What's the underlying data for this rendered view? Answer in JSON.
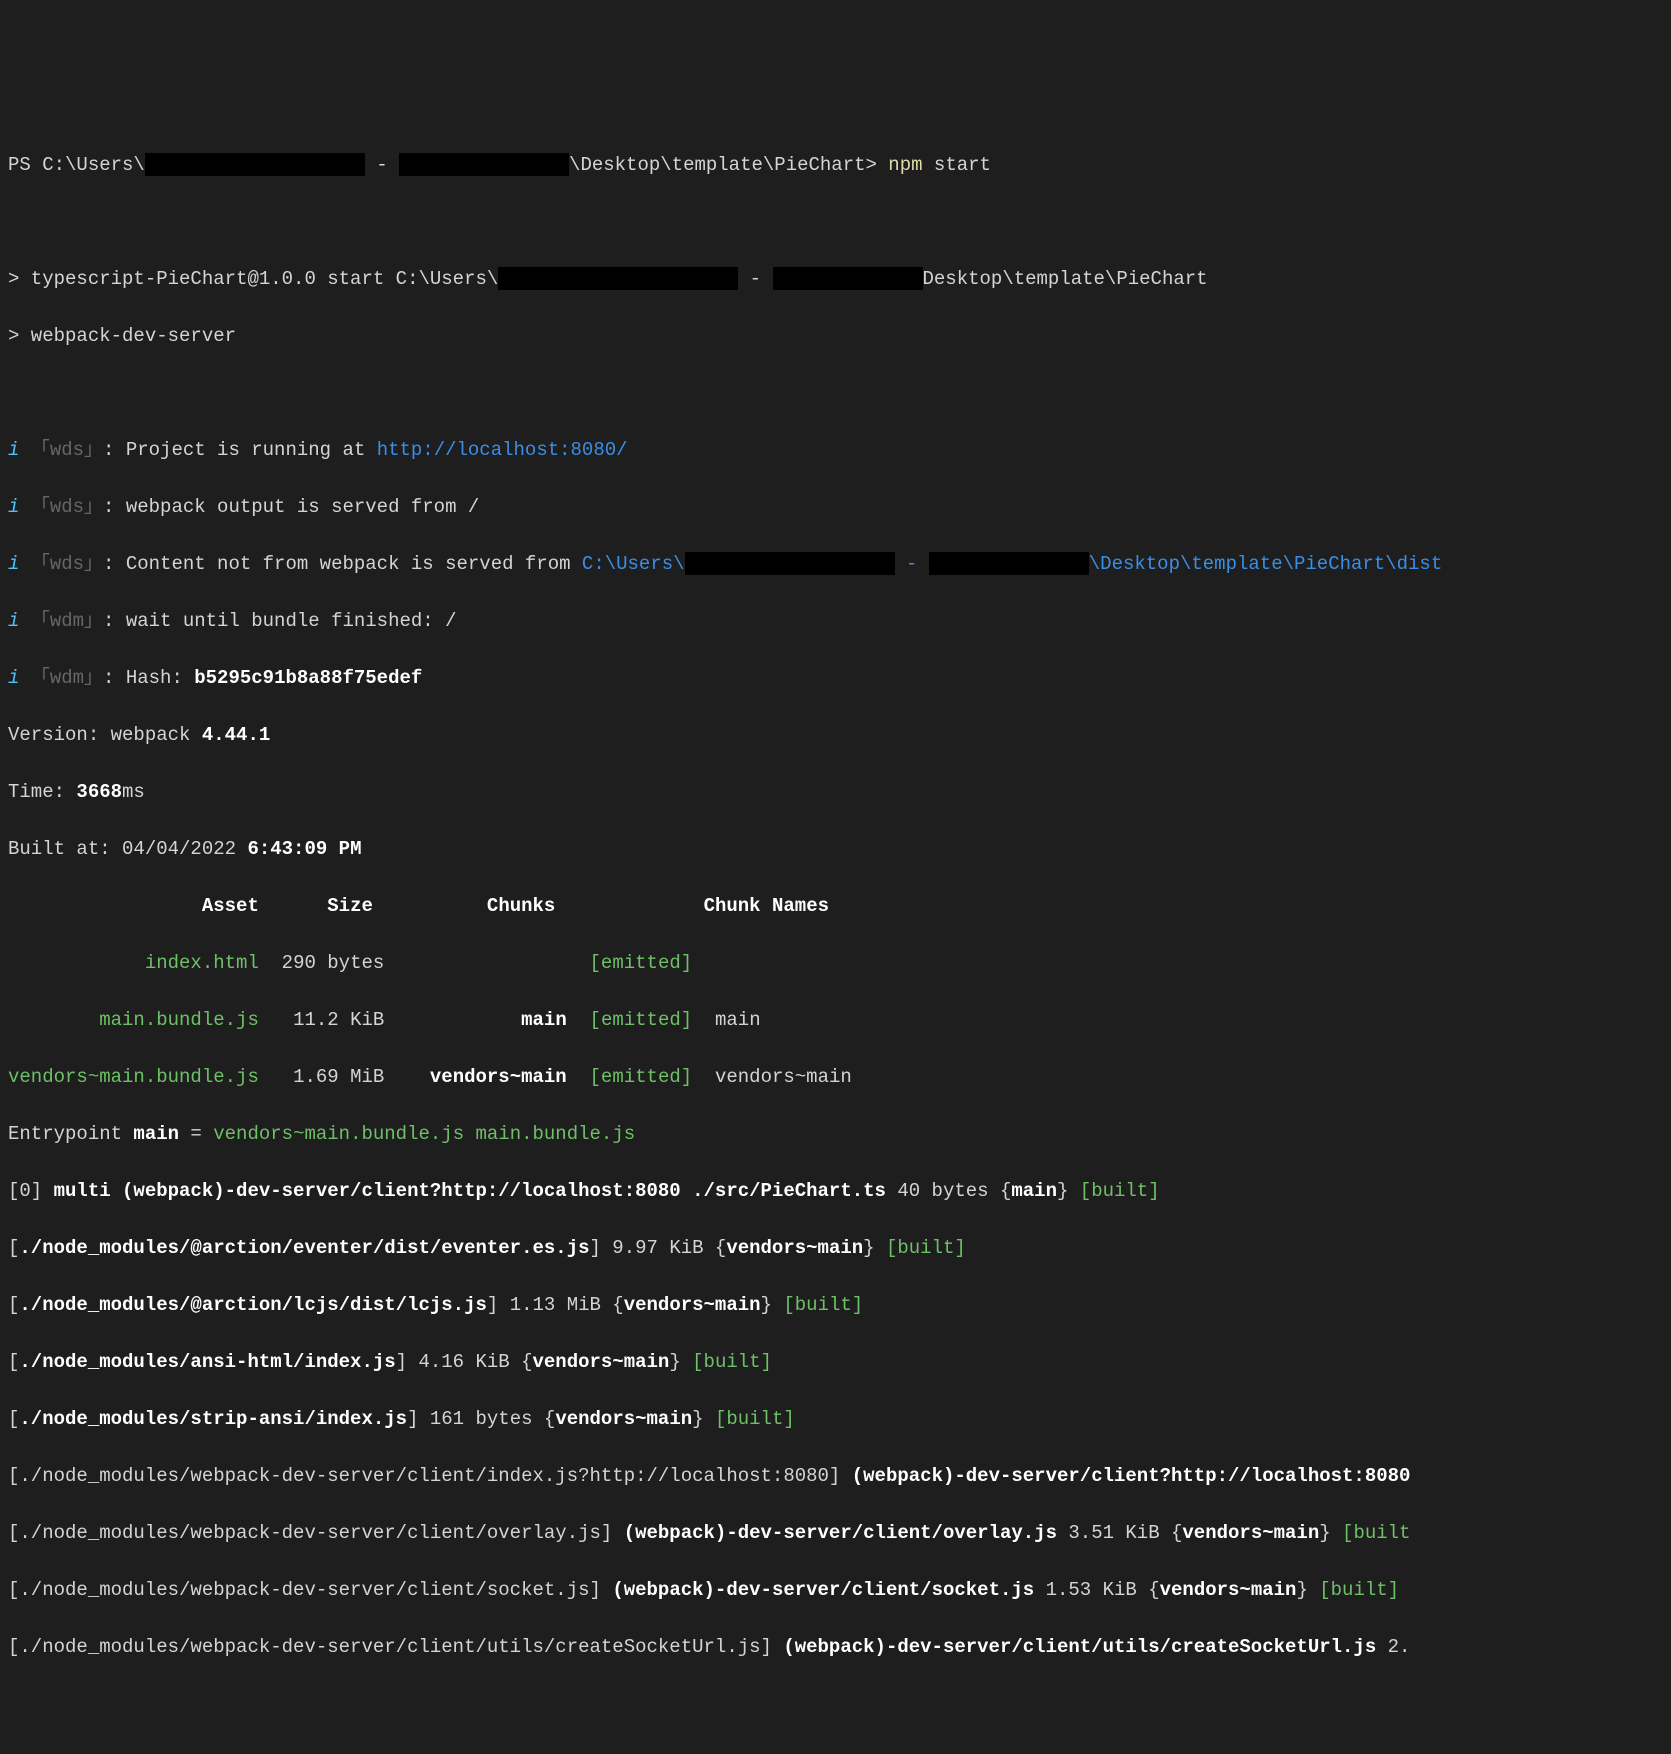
{
  "prompt": {
    "ps_prefix": "PS C:\\Users\\",
    "path_segment": "\\Desktop\\template\\PieChart>",
    "command": " npm",
    "command2": " start"
  },
  "scripts": {
    "prefix1": "> typescript-PieChart@1.0.0 start C:\\Users\\",
    "dash": " - ",
    "prefix1b": "Desktop\\template\\PieChart",
    "line2": "> webpack-dev-server"
  },
  "wds": {
    "tag": "「wds」",
    "l1a": ": Project is running at ",
    "l1b": "http://localhost:8080/",
    "l2": ": webpack output is served from /",
    "l3a": ": Content not from webpack is served from ",
    "l3b": "C:\\Users\\",
    "l3c": "\\Desktop\\template\\PieChart\\dist"
  },
  "wdm": {
    "tag": "「wdm」",
    "l1": ": wait until bundle finished: /",
    "l2a": ": Hash: ",
    "l2b": "b5295c91b8a88f75edef"
  },
  "version": {
    "a": "Version: webpack ",
    "b": "4.44.1"
  },
  "time": {
    "a": "Time: ",
    "b": "3668",
    "c": "ms"
  },
  "built": {
    "a": "Built at: 04/04/2022 ",
    "b": "6:43:09 PM"
  },
  "header": {
    "asset": "Asset",
    "size": "Size",
    "chunks": "Chunks",
    "names": "Chunk Names"
  },
  "rows": [
    {
      "asset": "index.html",
      "size": "290 bytes",
      "chunks": "",
      "emitted": "[emitted]",
      "names": ""
    },
    {
      "asset": "main.bundle.js",
      "size": "11.2 KiB",
      "chunks": "main",
      "emitted": "[emitted]",
      "names": "main"
    },
    {
      "asset": "vendors~main.bundle.js",
      "size": "1.69 MiB",
      "chunks": "vendors~main",
      "emitted": "[emitted]",
      "names": "vendors~main"
    }
  ],
  "entry": {
    "a": "Entrypoint ",
    "b": "main",
    "c": " = ",
    "d": "vendors~main.bundle.js main.bundle.js"
  },
  "modules": {
    "m0": {
      "a": "[0] ",
      "b": "multi (webpack)-dev-server/client?http://localhost:8080 ./src/PieChart.ts",
      "c": " 40 bytes {",
      "d": "main",
      "e": "} ",
      "f": "[built]"
    },
    "m1": {
      "a": "[",
      "b": "./node_modules/@arction/eventer/dist/eventer.es.js",
      "c": "] 9.97 KiB {",
      "d": "vendors~main",
      "e": "} ",
      "f": "[built]"
    },
    "m2": {
      "a": "[",
      "b": "./node_modules/@arction/lcjs/dist/lcjs.js",
      "c": "] 1.13 MiB {",
      "d": "vendors~main",
      "e": "} ",
      "f": "[built]"
    },
    "m3": {
      "a": "[",
      "b": "./node_modules/ansi-html/index.js",
      "c": "] 4.16 KiB {",
      "d": "vendors~main",
      "e": "} ",
      "f": "[built]"
    },
    "m4": {
      "a": "[",
      "b": "./node_modules/strip-ansi/index.js",
      "c": "] 161 bytes {",
      "d": "vendors~main",
      "e": "} ",
      "f": "[built]"
    },
    "m5": {
      "a": "[./node_modules/webpack-dev-server/client/index.js?http://localhost:8080] ",
      "b": "(webpack)-dev-server/client?http://localhost:8080"
    },
    "m6": {
      "a": "[./node_modules/webpack-dev-server/client/overlay.js] ",
      "b": "(webpack)-dev-server/client/overlay.js",
      "c": " 3.51 KiB {",
      "d": "vendors~main",
      "e": "} ",
      "f": "[built"
    },
    "m7": {
      "a": "[./node_modules/webpack-dev-server/client/socket.js] ",
      "b": "(webpack)-dev-server/client/socket.js",
      "c": " 1.53 KiB {",
      "d": "vendors~main",
      "e": "} ",
      "f": "[built]"
    },
    "m8": {
      "a": "[./node_modules/webpack-dev-server/client/utils/createSocketUrl.js] ",
      "b": "(webpack)-dev-server/client/utils/createSocketUrl.js",
      "c": " 2."
    }
  }
}
